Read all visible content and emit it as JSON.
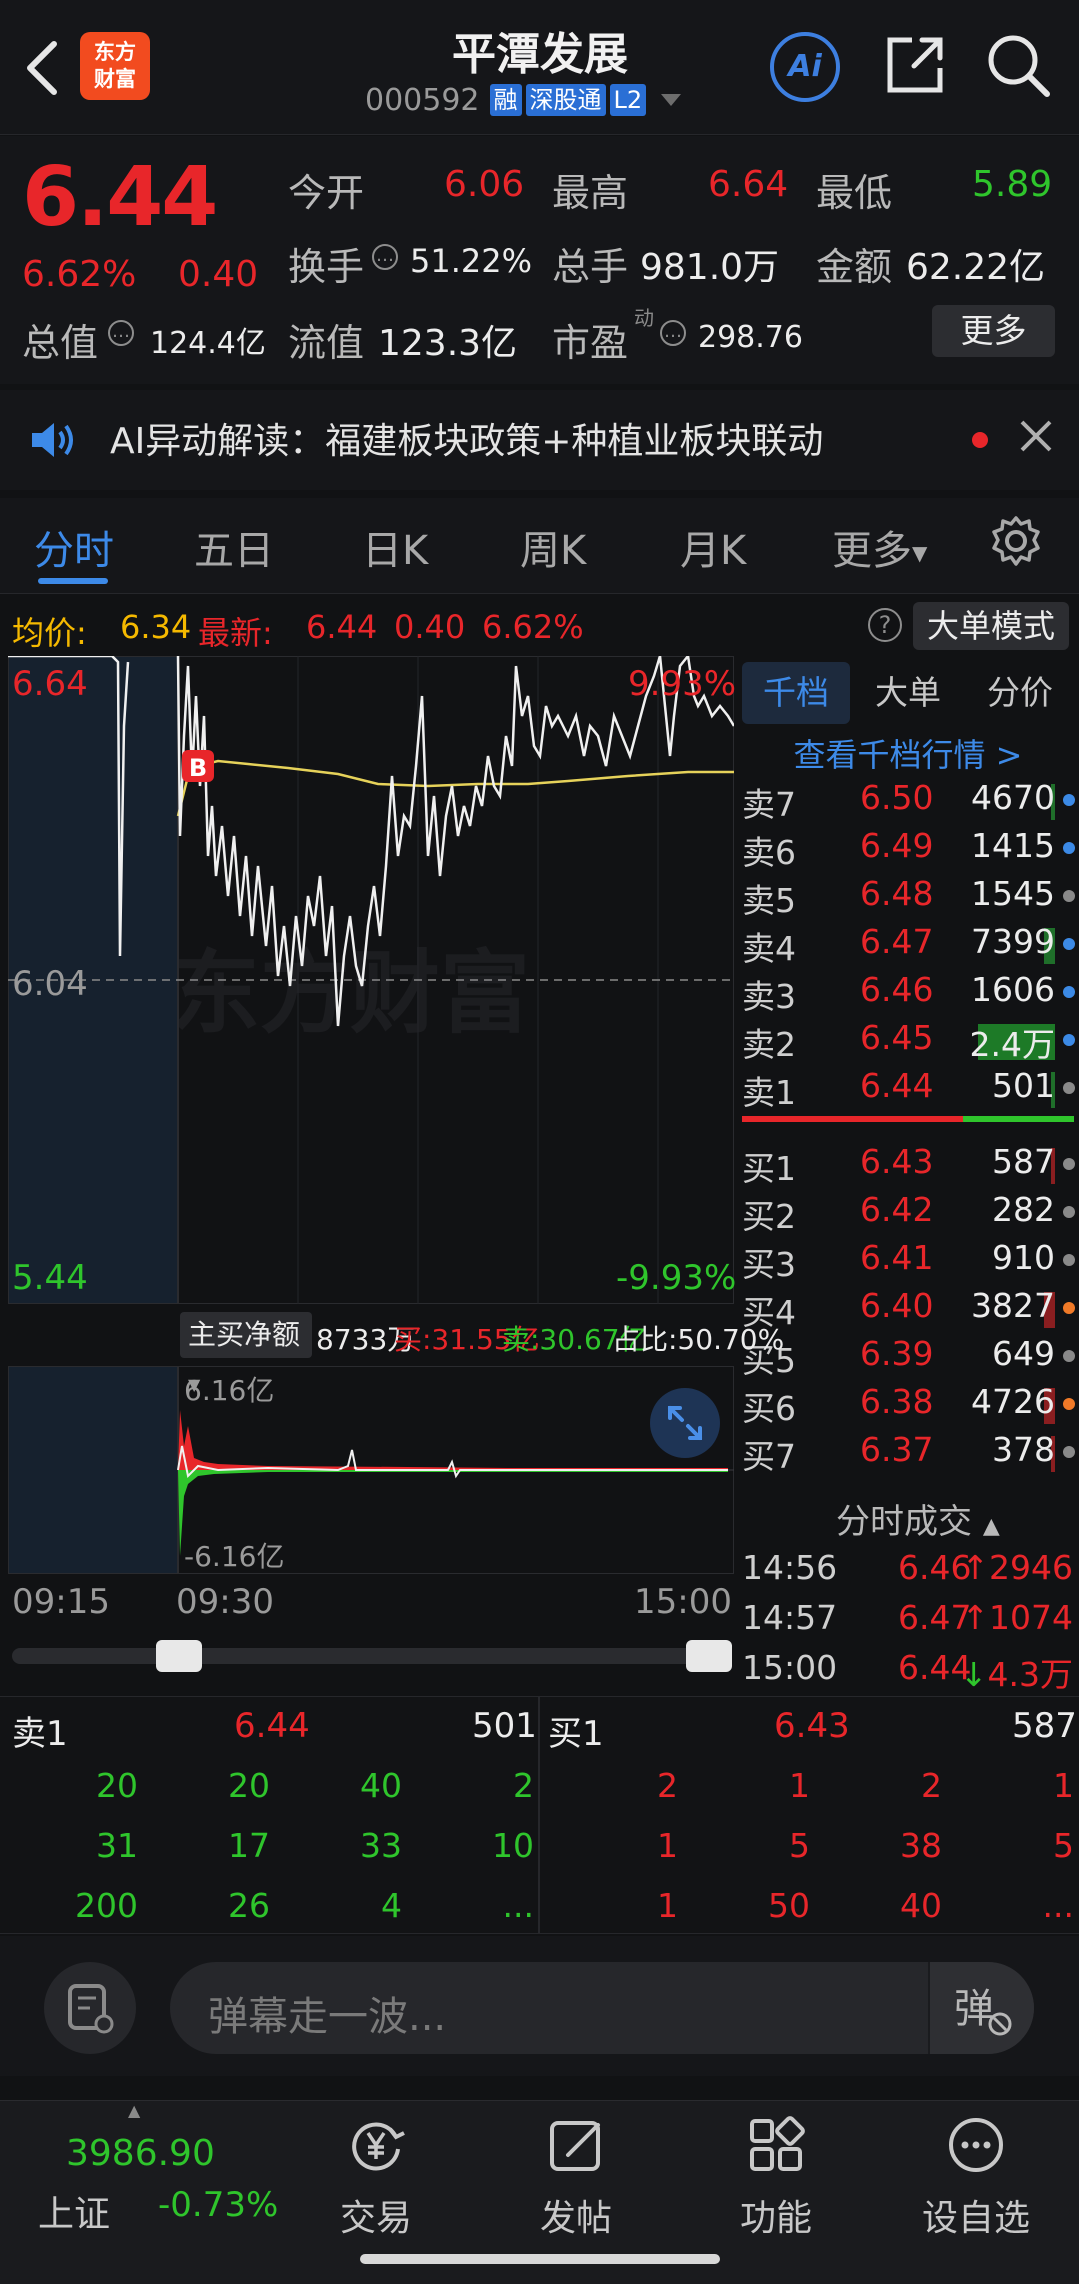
{
  "header": {
    "logo_text": "东方财富",
    "stock_name": "平潭发展",
    "stock_code": "000592",
    "tags": [
      "融",
      "深股通",
      "L2"
    ],
    "ai_label": "Ai"
  },
  "quote": {
    "price": "6.44",
    "change_pct": "6.62%",
    "change": "0.40",
    "fields": [
      {
        "label": "今开",
        "value": "6.06",
        "color": "red"
      },
      {
        "label": "最高",
        "value": "6.64",
        "color": "red"
      },
      {
        "label": "最低",
        "value": "5.89",
        "color": "green"
      },
      {
        "label": "换手",
        "value": "51.22%",
        "color": "white"
      },
      {
        "label": "总手",
        "value": "981.0万",
        "color": "white"
      },
      {
        "label": "金额",
        "value": "62.22亿",
        "color": "white"
      },
      {
        "label": "总值",
        "value": "124.4亿",
        "color": "white"
      },
      {
        "label": "流值",
        "value": "123.3亿",
        "color": "white"
      },
      {
        "label": "市盈",
        "sup": "动",
        "value": "298.76",
        "color": "white"
      }
    ],
    "more_label": "更多"
  },
  "ai_banner": {
    "text": "AI异动解读：福建板块政策+种植业板块联动"
  },
  "tabs": {
    "items": [
      "分时",
      "五日",
      "日K",
      "周K",
      "月K",
      "更多"
    ],
    "active": "分时"
  },
  "info_row": {
    "avg_label": "均价:",
    "avg_value": "6.34",
    "latest_label": "最新:",
    "latest_price": "6.44",
    "latest_change": "0.40",
    "latest_pct": "6.62%",
    "big_order_mode": "大单模式",
    "help": "?"
  },
  "chart": {
    "high_label": "6.64",
    "mid_label": "6.04",
    "low_label": "5.44",
    "high_pct": "9.93%",
    "low_pct": "-9.93%",
    "watermark": "东方财富",
    "marker": "B",
    "colors": {
      "price": "#f0f0f0",
      "avg": "#e6d25a",
      "up": "#e8262a",
      "down": "#2fc52c"
    }
  },
  "chart_data": {
    "type": "line",
    "x": [
      "09:15",
      "09:30",
      "15:00"
    ],
    "ylim": [
      5.44,
      6.64
    ],
    "reference": 6.04,
    "series": []
  },
  "order_book": {
    "tabs": [
      "千档",
      "大单",
      "分价"
    ],
    "active_tab": "千档",
    "view_link": "查看千档行情 >",
    "asks": [
      {
        "label": "卖7",
        "price": "6.50",
        "volume": "4670",
        "dot": "blue",
        "bar": 0.02
      },
      {
        "label": "卖6",
        "price": "6.49",
        "volume": "1415",
        "dot": "blue",
        "bar": 0
      },
      {
        "label": "卖5",
        "price": "6.48",
        "volume": "1545",
        "dot": "gray",
        "bar": 0
      },
      {
        "label": "卖4",
        "price": "6.47",
        "volume": "7399",
        "dot": "blue",
        "bar": 0.1
      },
      {
        "label": "卖3",
        "price": "6.46",
        "volume": "1606",
        "dot": "blue",
        "bar": 0
      },
      {
        "label": "卖2",
        "price": "6.45",
        "volume": "2.4万",
        "dot": "blue",
        "bar": 0.7
      },
      {
        "label": "卖1",
        "price": "6.44",
        "volume": "501",
        "dot": "gray",
        "bar": 0.02
      }
    ],
    "bids": [
      {
        "label": "买1",
        "price": "6.43",
        "volume": "587",
        "dot": "gray",
        "bar": 0.02
      },
      {
        "label": "买2",
        "price": "6.42",
        "volume": "282",
        "dot": "gray",
        "bar": 0
      },
      {
        "label": "买3",
        "price": "6.41",
        "volume": "910",
        "dot": "gray",
        "bar": 0
      },
      {
        "label": "买4",
        "price": "6.40",
        "volume": "3827",
        "dot": "orange",
        "bar": 0.1
      },
      {
        "label": "买5",
        "price": "6.39",
        "volume": "649",
        "dot": "gray",
        "bar": 0
      },
      {
        "label": "买6",
        "price": "6.38",
        "volume": "4726",
        "dot": "orange",
        "bar": 0.1
      },
      {
        "label": "买7",
        "price": "6.37",
        "volume": "378",
        "dot": "gray",
        "bar": 0.02
      }
    ]
  },
  "sub_chart": {
    "selector": "主买净额",
    "net": "8733万",
    "buy": "买:31.55亿",
    "sell": "卖:30.67亿",
    "ratio": "占比:50.70%",
    "top": "6.16亿",
    "bottom": "-6.16亿"
  },
  "time_axis": [
    "09:15",
    "09:30",
    "15:00"
  ],
  "ticks": {
    "title": "分时成交",
    "rows": [
      {
        "time": "14:56",
        "price": "6.46",
        "arrow": "↑",
        "volume": "2946",
        "color": "red"
      },
      {
        "time": "14:57",
        "price": "6.47",
        "arrow": "↑",
        "volume": "1074",
        "color": "red"
      },
      {
        "time": "15:00",
        "price": "6.44",
        "arrow": "↓",
        "volume": "4.3万",
        "color": "red"
      }
    ]
  },
  "queue": {
    "sell_label": "卖1",
    "sell_price": "6.44",
    "sell_volume": "501",
    "buy_label": "买1",
    "buy_price": "6.43",
    "buy_volume": "587",
    "sell_rows": [
      [
        "20",
        "20",
        "40",
        "2"
      ],
      [
        "31",
        "17",
        "33",
        "10"
      ],
      [
        "200",
        "26",
        "4",
        "..."
      ]
    ],
    "buy_rows": [
      [
        "2",
        "1",
        "2",
        "1"
      ],
      [
        "1",
        "5",
        "38",
        "5"
      ],
      [
        "1",
        "50",
        "40",
        "..."
      ]
    ]
  },
  "comment": {
    "placeholder": "弹幕走一波..."
  },
  "bottom_nav": {
    "index_value": "3986.90",
    "index_name": "上证",
    "index_change": "-0.73%",
    "items": [
      "交易",
      "发帖",
      "功能",
      "设自选"
    ]
  }
}
